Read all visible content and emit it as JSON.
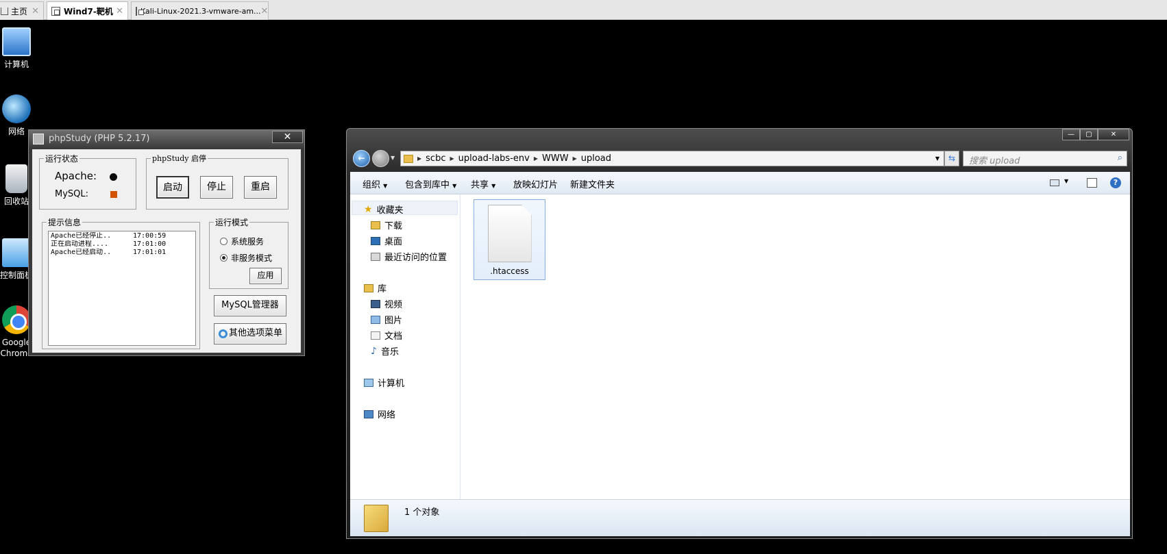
{
  "tabs": [
    {
      "label": "主页"
    },
    {
      "label": "Wind7-靶机"
    },
    {
      "label": "Kali-Linux-2021.3-vmware-am..."
    }
  ],
  "desktop": {
    "icons": [
      {
        "label": "计算机"
      },
      {
        "label": "网络"
      },
      {
        "label": "回收站"
      },
      {
        "label": "控制面板"
      },
      {
        "label": "Google Chrome"
      }
    ]
  },
  "phpstudy": {
    "title": "phpStudy (PHP 5.2.17)",
    "close": "✕",
    "status_group": "运行状态",
    "apache_label": "Apache:",
    "mysql_label": "MySQL:",
    "apache_status_color": "#0a0a0a",
    "mysql_status_color": "#d35400",
    "startstop_group": "phpStudy 启停",
    "start_btn": "启动",
    "stop_btn": "停止",
    "restart_btn": "重启",
    "info_group": "提示信息",
    "log": [
      {
        "msg": "Apache已经停止..",
        "time": "17:00:59"
      },
      {
        "msg": "正在启动进程....",
        "time": "17:01:00"
      },
      {
        "msg": "Apache已经启动..",
        "time": "17:01:01"
      }
    ],
    "mode_group": "运行模式",
    "mode_service": "系统服务",
    "mode_nonservice": "非服务模式",
    "apply_btn": "应用",
    "mysql_mgr_btn": "MySQL管理器",
    "other_menu_btn": "其他选项菜单"
  },
  "explorer": {
    "breadcrumb": [
      "scbc",
      "upload-labs-env",
      "WWW",
      "upload"
    ],
    "search_placeholder": "搜索 upload",
    "toolbar": {
      "organize": "组织",
      "include_library": "包含到库中",
      "share": "共享",
      "slideshow": "放映幻灯片",
      "new_folder": "新建文件夹"
    },
    "nav": {
      "favorites": "收藏夹",
      "downloads": "下载",
      "desktop": "桌面",
      "recent": "最近访问的位置",
      "libraries": "库",
      "videos": "视频",
      "pictures": "图片",
      "documents": "文档",
      "music": "音乐",
      "computer": "计算机",
      "network": "网络"
    },
    "files": [
      {
        "name": ".htaccess"
      }
    ],
    "status": "1 个对象"
  }
}
